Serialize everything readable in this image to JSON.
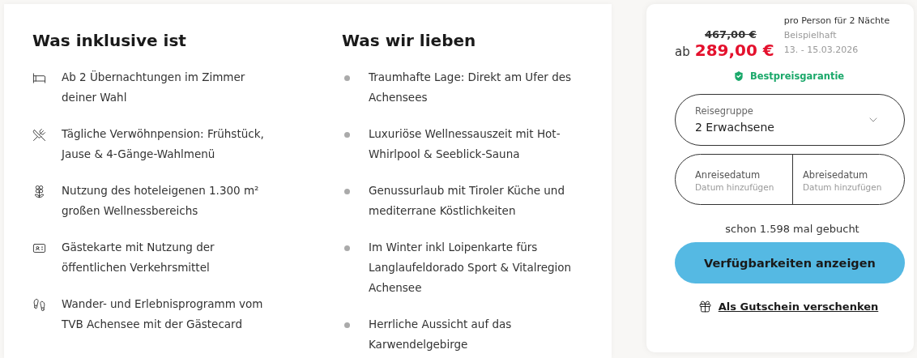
{
  "included": {
    "title": "Was inklusive ist",
    "items": [
      {
        "kind": "bed",
        "text": "Ab 2 Übernachtungen im Zimmer deiner Wahl"
      },
      {
        "kind": "dining",
        "text": "Tägliche Verwöhnpension: Frühstück, Jause & 4-Gänge-Wahlmenü"
      },
      {
        "kind": "lotus",
        "text": "Nutzung des hoteleigenen 1.300 m² großen Wellnessbereichs"
      },
      {
        "kind": "card",
        "text": "Gästekarte mit Nutzung der öffentlichen Verkehrsmittel"
      },
      {
        "kind": "hiking",
        "text": "Wander- und Erlebnisprogramm vom TVB Achensee mit der Gästecard"
      }
    ]
  },
  "loved": {
    "title": "Was wir lieben",
    "items": [
      "Traumhafte Lage: Direkt am Ufer des Achensees",
      "Luxuriöse Wellnessauszeit mit Hot-Whirlpool & Seeblick-Sauna",
      "Genussurlaub mit Tiroler Küche und mediterrane Köstlichkeiten",
      "Im Winter inkl Loipenkarte fürs Langlaufeldorado Sport & Vitalregion Achensee",
      "Herrliche Aussicht auf das Karwendelgebirge"
    ]
  },
  "booking": {
    "old_price": "467,00 €",
    "prefix": "ab",
    "price": "289,00 €",
    "per": "pro Person für 2 Nächte",
    "example": "Beispielhaft",
    "dates": "13. - 15.03.2026",
    "guarantee": "Bestpreisgarantie",
    "group": {
      "label": "Reisegruppe",
      "value": "2 Erwachsene"
    },
    "arrival": {
      "label": "Anreisedatum",
      "placeholder": "Datum hinzufügen"
    },
    "departure": {
      "label": "Abreisedatum",
      "placeholder": "Datum hinzufügen"
    },
    "booked": "schon 1.598 mal gebucht",
    "cta": "Verfügbarkeiten anzeigen",
    "voucher": "Als Gutschein verschenken"
  }
}
